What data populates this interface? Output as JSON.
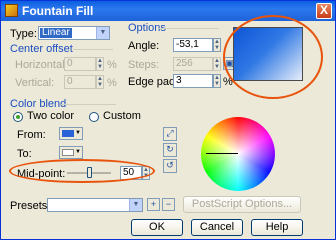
{
  "window": {
    "title": "Fountain Fill",
    "close_glyph": "X"
  },
  "type_field": {
    "label": "Type:",
    "value": "Linear"
  },
  "center_offset": {
    "heading": "Center offset",
    "horizontal_label": "Horizontal:",
    "horizontal_value": "0",
    "horizontal_unit": "%",
    "vertical_label": "Vertical:",
    "vertical_value": "0",
    "vertical_unit": "%"
  },
  "options": {
    "heading": "Options",
    "angle_label": "Angle:",
    "angle_value": "-53,1",
    "steps_label": "Steps:",
    "steps_value": "256",
    "edge_pad_label": "Edge pad:",
    "edge_pad_value": "3",
    "edge_pad_unit": "%"
  },
  "color_blend": {
    "heading": "Color blend",
    "two_color_label": "Two color",
    "custom_label": "Custom",
    "selected": "two_color",
    "from_label": "From:",
    "from_color": "#2a62d8",
    "to_label": "To:",
    "to_color": "#ffffff",
    "mid_point_label": "Mid-point:",
    "mid_point_value": "50",
    "mid_point_level": 0.5
  },
  "presets": {
    "label": "Presets:",
    "value": "",
    "postscript_button": "PostScript Options..."
  },
  "buttons": {
    "ok": "OK",
    "cancel": "Cancel",
    "help": "Help"
  },
  "colors": {
    "preview_start": "#0f55d8",
    "preview_end": "#e6eefa",
    "highlight_ellipse": "#e8540c",
    "title_bar": "#0a5fe0"
  },
  "icons": [
    "app-icon",
    "close-icon",
    "lock-icon",
    "curve-icon",
    "spiral-cw-icon",
    "spiral-ccw-icon",
    "add-preset-icon",
    "remove-preset-icon"
  ]
}
